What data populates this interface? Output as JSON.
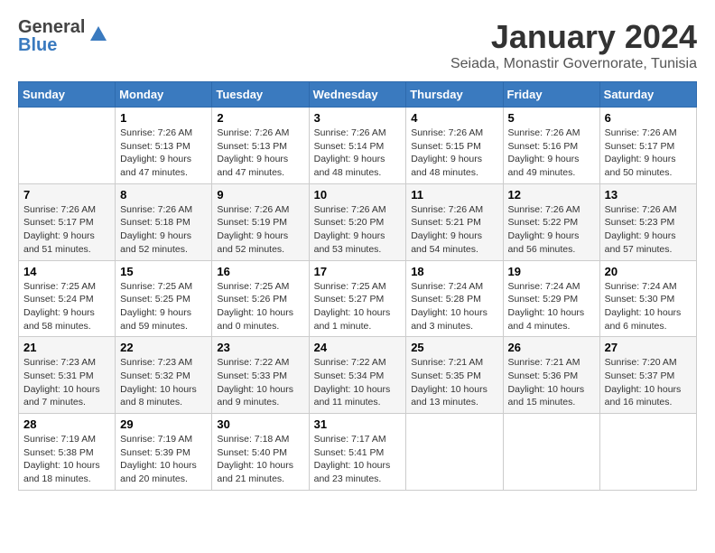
{
  "header": {
    "logo_general": "General",
    "logo_blue": "Blue",
    "month_year": "January 2024",
    "location": "Seiada, Monastir Governorate, Tunisia"
  },
  "calendar": {
    "days_of_week": [
      "Sunday",
      "Monday",
      "Tuesday",
      "Wednesday",
      "Thursday",
      "Friday",
      "Saturday"
    ],
    "weeks": [
      [
        {
          "day": "",
          "info": ""
        },
        {
          "day": "1",
          "info": "Sunrise: 7:26 AM\nSunset: 5:13 PM\nDaylight: 9 hours\nand 47 minutes."
        },
        {
          "day": "2",
          "info": "Sunrise: 7:26 AM\nSunset: 5:13 PM\nDaylight: 9 hours\nand 47 minutes."
        },
        {
          "day": "3",
          "info": "Sunrise: 7:26 AM\nSunset: 5:14 PM\nDaylight: 9 hours\nand 48 minutes."
        },
        {
          "day": "4",
          "info": "Sunrise: 7:26 AM\nSunset: 5:15 PM\nDaylight: 9 hours\nand 48 minutes."
        },
        {
          "day": "5",
          "info": "Sunrise: 7:26 AM\nSunset: 5:16 PM\nDaylight: 9 hours\nand 49 minutes."
        },
        {
          "day": "6",
          "info": "Sunrise: 7:26 AM\nSunset: 5:17 PM\nDaylight: 9 hours\nand 50 minutes."
        }
      ],
      [
        {
          "day": "7",
          "info": "Sunrise: 7:26 AM\nSunset: 5:17 PM\nDaylight: 9 hours\nand 51 minutes."
        },
        {
          "day": "8",
          "info": "Sunrise: 7:26 AM\nSunset: 5:18 PM\nDaylight: 9 hours\nand 52 minutes."
        },
        {
          "day": "9",
          "info": "Sunrise: 7:26 AM\nSunset: 5:19 PM\nDaylight: 9 hours\nand 52 minutes."
        },
        {
          "day": "10",
          "info": "Sunrise: 7:26 AM\nSunset: 5:20 PM\nDaylight: 9 hours\nand 53 minutes."
        },
        {
          "day": "11",
          "info": "Sunrise: 7:26 AM\nSunset: 5:21 PM\nDaylight: 9 hours\nand 54 minutes."
        },
        {
          "day": "12",
          "info": "Sunrise: 7:26 AM\nSunset: 5:22 PM\nDaylight: 9 hours\nand 56 minutes."
        },
        {
          "day": "13",
          "info": "Sunrise: 7:26 AM\nSunset: 5:23 PM\nDaylight: 9 hours\nand 57 minutes."
        }
      ],
      [
        {
          "day": "14",
          "info": "Sunrise: 7:25 AM\nSunset: 5:24 PM\nDaylight: 9 hours\nand 58 minutes."
        },
        {
          "day": "15",
          "info": "Sunrise: 7:25 AM\nSunset: 5:25 PM\nDaylight: 9 hours\nand 59 minutes."
        },
        {
          "day": "16",
          "info": "Sunrise: 7:25 AM\nSunset: 5:26 PM\nDaylight: 10 hours\nand 0 minutes."
        },
        {
          "day": "17",
          "info": "Sunrise: 7:25 AM\nSunset: 5:27 PM\nDaylight: 10 hours\nand 1 minute."
        },
        {
          "day": "18",
          "info": "Sunrise: 7:24 AM\nSunset: 5:28 PM\nDaylight: 10 hours\nand 3 minutes."
        },
        {
          "day": "19",
          "info": "Sunrise: 7:24 AM\nSunset: 5:29 PM\nDaylight: 10 hours\nand 4 minutes."
        },
        {
          "day": "20",
          "info": "Sunrise: 7:24 AM\nSunset: 5:30 PM\nDaylight: 10 hours\nand 6 minutes."
        }
      ],
      [
        {
          "day": "21",
          "info": "Sunrise: 7:23 AM\nSunset: 5:31 PM\nDaylight: 10 hours\nand 7 minutes."
        },
        {
          "day": "22",
          "info": "Sunrise: 7:23 AM\nSunset: 5:32 PM\nDaylight: 10 hours\nand 8 minutes."
        },
        {
          "day": "23",
          "info": "Sunrise: 7:22 AM\nSunset: 5:33 PM\nDaylight: 10 hours\nand 9 minutes."
        },
        {
          "day": "24",
          "info": "Sunrise: 7:22 AM\nSunset: 5:34 PM\nDaylight: 10 hours\nand 11 minutes."
        },
        {
          "day": "25",
          "info": "Sunrise: 7:21 AM\nSunset: 5:35 PM\nDaylight: 10 hours\nand 13 minutes."
        },
        {
          "day": "26",
          "info": "Sunrise: 7:21 AM\nSunset: 5:36 PM\nDaylight: 10 hours\nand 15 minutes."
        },
        {
          "day": "27",
          "info": "Sunrise: 7:20 AM\nSunset: 5:37 PM\nDaylight: 10 hours\nand 16 minutes."
        }
      ],
      [
        {
          "day": "28",
          "info": "Sunrise: 7:19 AM\nSunset: 5:38 PM\nDaylight: 10 hours\nand 18 minutes."
        },
        {
          "day": "29",
          "info": "Sunrise: 7:19 AM\nSunset: 5:39 PM\nDaylight: 10 hours\nand 20 minutes."
        },
        {
          "day": "30",
          "info": "Sunrise: 7:18 AM\nSunset: 5:40 PM\nDaylight: 10 hours\nand 21 minutes."
        },
        {
          "day": "31",
          "info": "Sunrise: 7:17 AM\nSunset: 5:41 PM\nDaylight: 10 hours\nand 23 minutes."
        },
        {
          "day": "",
          "info": ""
        },
        {
          "day": "",
          "info": ""
        },
        {
          "day": "",
          "info": ""
        }
      ]
    ]
  }
}
